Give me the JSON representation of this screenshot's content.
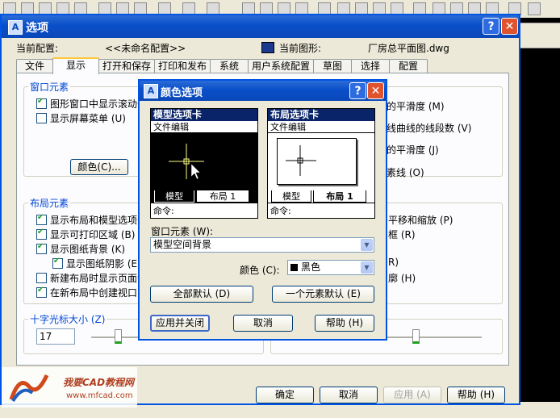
{
  "main_dialog": {
    "title": "选项",
    "help_glyph": "?",
    "close_glyph": "✕",
    "current_config_label": "当前配置:",
    "current_config_value": "<<未命名配置>>",
    "current_drawing_label": "当前图形:",
    "current_drawing_value": "厂房总平面图.dwg",
    "tabs": [
      "文件",
      "显示",
      "打开和保存",
      "打印和发布",
      "系统",
      "用户系统配置",
      "草图",
      "选择",
      "配置"
    ],
    "active_tab": "显示",
    "window_elements": {
      "title": "窗口元素",
      "checkboxes": [
        {
          "label": "图形窗口中显示滚动条",
          "checked": true
        },
        {
          "label": "显示屏幕菜单 (U)",
          "checked": false
        }
      ],
      "color_button": "颜色(C)..."
    },
    "right_fragments": {
      "smoothness": "的平滑度 (M)",
      "segments": "线曲线的线段数 (V)",
      "smoothness2": "的平滑度 (J)",
      "lines": "素线 (O)",
      "pan_zoom": "平移和缩放 (P)",
      "frame": "框 (R)",
      "r_frag": "R)",
      "hm_frag": "廓 (H)"
    },
    "layout_elements": {
      "title": "布局元素",
      "checkboxes": [
        {
          "label": "显示布局和模型选项卡",
          "checked": true
        },
        {
          "label": "显示可打印区域 (B)",
          "checked": true
        },
        {
          "label": "显示图纸背景 (K)",
          "checked": true
        },
        {
          "label": "显示图纸阴影 (E)",
          "checked": true
        },
        {
          "label": "新建布局时显示页面设",
          "checked": false
        },
        {
          "label": "在新布局中创建视口",
          "checked": true
        }
      ]
    },
    "crosshair": {
      "title": "十字光标大小 (Z)",
      "value": "17"
    },
    "buttons": {
      "ok": "确定",
      "cancel": "取消",
      "apply": "应用 (A)",
      "help": "帮助 (H)"
    }
  },
  "color_dialog": {
    "title": "颜色选项",
    "help_glyph": "?",
    "close_glyph": "✕",
    "model_preview": {
      "header": "模型选项卡",
      "menu": "文件编辑",
      "tabs": [
        "模型",
        "布局 1"
      ],
      "command": "命令:"
    },
    "layout_preview": {
      "header": "布局选项卡",
      "menu": "文件编辑",
      "tabs": [
        "模型",
        "布局 1"
      ],
      "command": "命令:"
    },
    "window_element_label": "窗口元素 (W):",
    "window_element_value": "模型空间背景",
    "color_label": "颜色 (C):",
    "color_value": "黑色",
    "restore_all": "全部默认 (D)",
    "restore_one": "一个元素默认 (E)",
    "apply_close": "应用并关闭",
    "cancel": "取消",
    "help": "帮助 (H)"
  },
  "watermark": {
    "text_cn": "我要CAD教程网",
    "url": "www.mfcad.com"
  },
  "colors": {
    "titlebar": "#0a48b8",
    "accent": "#0046d5",
    "model_bg": "#000000",
    "close": "#e0532f"
  }
}
